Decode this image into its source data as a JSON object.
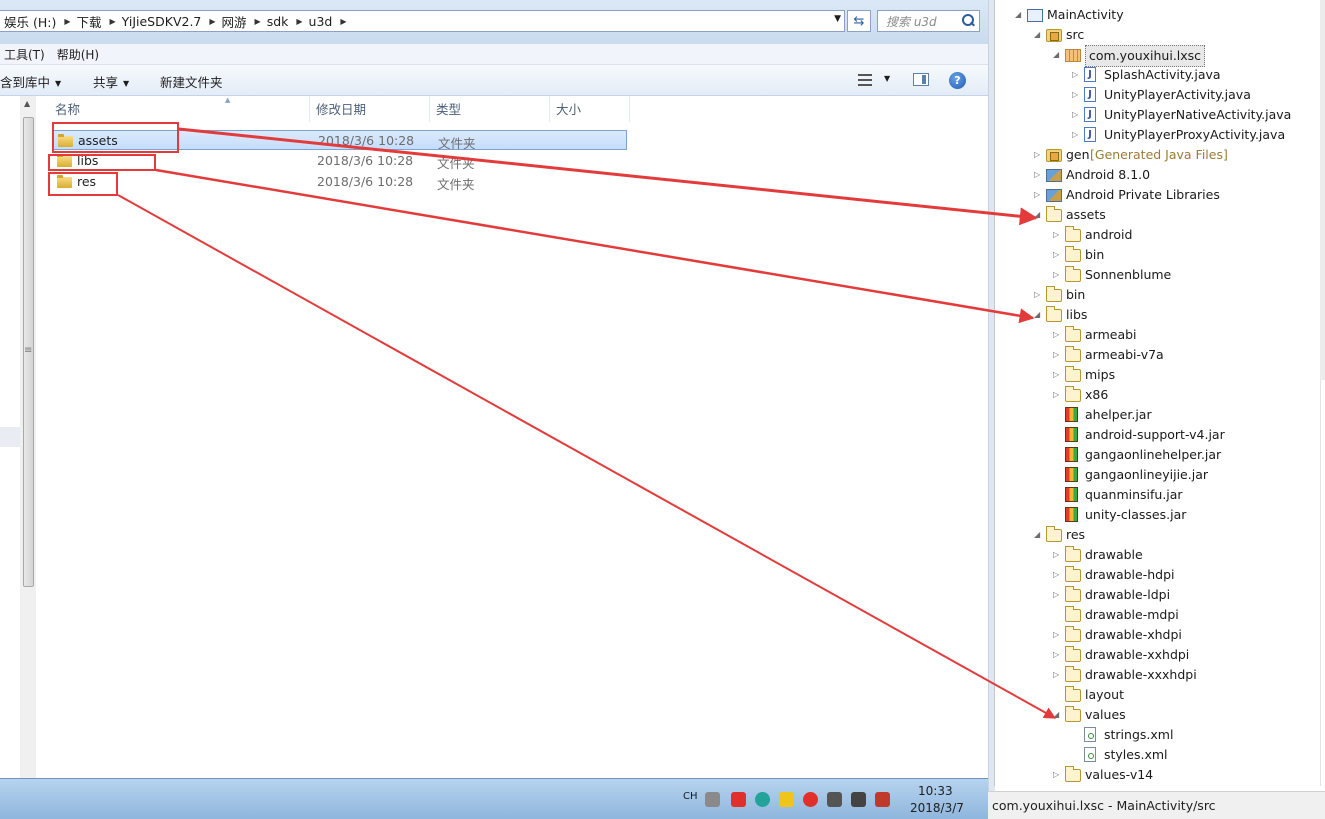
{
  "explorer": {
    "breadcrumbs": [
      "娱乐 (H:)",
      "下载",
      "YiJieSDKV2.7",
      "网游",
      "sdk",
      "u3d"
    ],
    "search_placeholder": "搜索 u3d",
    "menu": [
      "工具(T)",
      "帮助(H)"
    ],
    "toolbar": {
      "include_library": "含到库中",
      "share": "共享",
      "new_folder": "新建文件夹"
    },
    "columns": [
      "名称",
      "修改日期",
      "类型",
      "大小"
    ],
    "files": [
      {
        "name": "assets",
        "modified": "2018/3/6 10:28",
        "type": "文件夹"
      },
      {
        "name": "libs",
        "modified": "2018/3/6 10:28",
        "type": "文件夹"
      },
      {
        "name": "res",
        "modified": "2018/3/6 10:28",
        "type": "文件夹"
      }
    ]
  },
  "taskbar": {
    "ime": "CH",
    "time": "10:33",
    "date": "2018/3/7",
    "tray_colors": [
      "#8a8a8a",
      "#e0302b",
      "#23a39a",
      "#f0c419",
      "#e0302b",
      "#555555",
      "#444444",
      "#c0392b"
    ]
  },
  "eclipse": {
    "tree": [
      {
        "label": "MainActivity",
        "icon": "project-icon",
        "twisty": "expanded"
      },
      {
        "label": "src",
        "icon": "source-folder-icon",
        "twisty": "expanded"
      },
      {
        "label": "com.youxihui.lxsc",
        "icon": "package-icon",
        "twisty": "expanded"
      },
      {
        "label": "SplashActivity.java",
        "icon": "java-file-icon",
        "twisty": "collapsed"
      },
      {
        "label": "UnityPlayerActivity.java",
        "icon": "java-file-icon",
        "twisty": "collapsed"
      },
      {
        "label": "UnityPlayerNativeActivity.java",
        "icon": "java-file-icon",
        "twisty": "collapsed"
      },
      {
        "label": "UnityPlayerProxyActivity.java",
        "icon": "java-file-icon",
        "twisty": "collapsed"
      },
      {
        "label": "gen",
        "decoration": "[Generated Java Files]",
        "icon": "source-folder-icon",
        "twisty": "collapsed"
      },
      {
        "label": "Android 8.1.0",
        "icon": "library-icon",
        "twisty": "collapsed"
      },
      {
        "label": "Android Private Libraries",
        "icon": "library-icon",
        "twisty": "collapsed"
      },
      {
        "label": "assets",
        "icon": "folder-icon",
        "twisty": "expanded"
      },
      {
        "label": "android",
        "icon": "folder-icon",
        "twisty": "collapsed"
      },
      {
        "label": "bin",
        "icon": "folder-icon",
        "twisty": "collapsed"
      },
      {
        "label": "Sonnenblume",
        "icon": "folder-icon",
        "twisty": "collapsed"
      },
      {
        "label": "bin",
        "icon": "folder-icon",
        "twisty": "collapsed"
      },
      {
        "label": "libs",
        "icon": "folder-icon",
        "twisty": "expanded"
      },
      {
        "label": "armeabi",
        "icon": "folder-icon",
        "twisty": "collapsed"
      },
      {
        "label": "armeabi-v7a",
        "icon": "folder-icon",
        "twisty": "collapsed"
      },
      {
        "label": "mips",
        "icon": "folder-icon",
        "twisty": "collapsed"
      },
      {
        "label": "x86",
        "icon": "folder-icon",
        "twisty": "collapsed"
      },
      {
        "label": "ahelper.jar",
        "icon": "jar-icon",
        "twisty": "none"
      },
      {
        "label": "android-support-v4.jar",
        "icon": "jar-icon",
        "twisty": "none"
      },
      {
        "label": "gangaonlinehelper.jar",
        "icon": "jar-icon",
        "twisty": "none"
      },
      {
        "label": "gangaonlineyijie.jar",
        "icon": "jar-icon",
        "twisty": "none"
      },
      {
        "label": "quanminsifu.jar",
        "icon": "jar-icon",
        "twisty": "none"
      },
      {
        "label": "unity-classes.jar",
        "icon": "jar-icon",
        "twisty": "none"
      },
      {
        "label": "res",
        "icon": "folder-icon",
        "twisty": "expanded"
      },
      {
        "label": "drawable",
        "icon": "folder-icon",
        "twisty": "collapsed"
      },
      {
        "label": "drawable-hdpi",
        "icon": "folder-icon",
        "twisty": "collapsed"
      },
      {
        "label": "drawable-ldpi",
        "icon": "folder-icon",
        "twisty": "collapsed"
      },
      {
        "label": "drawable-mdpi",
        "icon": "folder-icon",
        "twisty": "none"
      },
      {
        "label": "drawable-xhdpi",
        "icon": "folder-icon",
        "twisty": "collapsed"
      },
      {
        "label": "drawable-xxhdpi",
        "icon": "folder-icon",
        "twisty": "collapsed"
      },
      {
        "label": "drawable-xxxhdpi",
        "icon": "folder-icon",
        "twisty": "collapsed"
      },
      {
        "label": "layout",
        "icon": "folder-icon",
        "twisty": "none"
      },
      {
        "label": "values",
        "icon": "folder-icon",
        "twisty": "expanded"
      },
      {
        "label": "strings.xml",
        "icon": "xml-file-icon",
        "twisty": "none"
      },
      {
        "label": "styles.xml",
        "icon": "xml-file-icon",
        "twisty": "none"
      },
      {
        "label": "values-v14",
        "icon": "folder-icon",
        "twisty": "collapsed"
      }
    ],
    "status": "com.youxihui.lxsc - MainActivity/src"
  },
  "annotation_color": "#e33b3b"
}
